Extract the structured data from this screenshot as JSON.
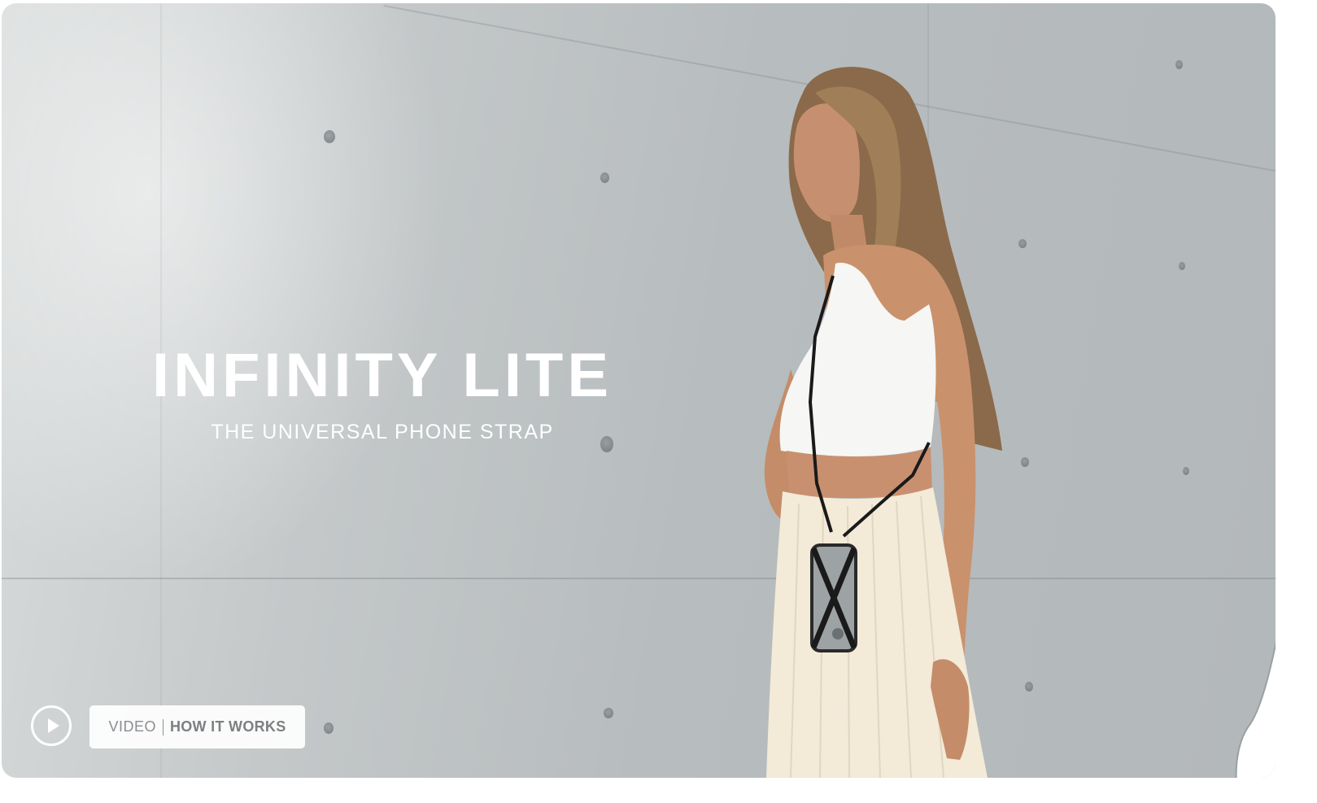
{
  "hero": {
    "title": "INFINITY LITE",
    "subtitle": "THE UNIVERSAL PHONE STRAP",
    "image_alt": "woman wearing phone strap"
  },
  "video_cta": {
    "play_icon": "play-icon",
    "prefix": "VIDEO",
    "label": "HOW IT WORKS"
  },
  "colors": {
    "text": "#ffffff",
    "pill_bg": "#ffffff",
    "pill_text": "#8a8e90"
  }
}
